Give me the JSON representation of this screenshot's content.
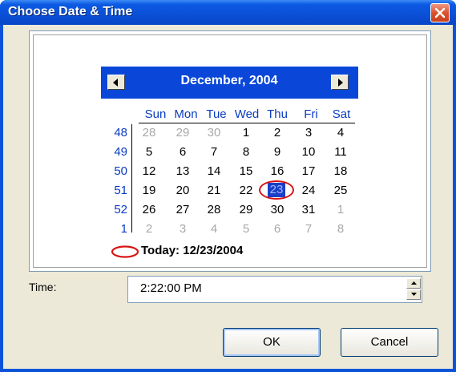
{
  "window": {
    "title": "Choose Date & Time",
    "close_icon": "close-icon"
  },
  "calendar": {
    "month_year": "December, 2004",
    "prev_icon": "triangle-left-icon",
    "next_icon": "triangle-right-icon",
    "days_of_week": [
      "Sun",
      "Mon",
      "Tue",
      "Wed",
      "Thu",
      "Fri",
      "Sat"
    ],
    "week_numbers": [
      "48",
      "49",
      "50",
      "51",
      "52",
      "1"
    ],
    "weeks": [
      [
        "28",
        "29",
        "30",
        "1",
        "2",
        "3",
        "4"
      ],
      [
        "5",
        "6",
        "7",
        "8",
        "9",
        "10",
        "11"
      ],
      [
        "12",
        "13",
        "14",
        "15",
        "16",
        "17",
        "18"
      ],
      [
        "19",
        "20",
        "21",
        "22",
        "23",
        "24",
        "25"
      ],
      [
        "26",
        "27",
        "28",
        "29",
        "30",
        "31",
        "1"
      ],
      [
        "2",
        "3",
        "4",
        "5",
        "6",
        "7",
        "8"
      ]
    ],
    "selected_day": "23",
    "today_label": "Today: 12/23/2004",
    "accent_color": "#0a47d8",
    "highlight_color": "#d81414"
  },
  "time": {
    "label": "Time:",
    "value": "2:22:00 PM"
  },
  "buttons": {
    "ok": "OK",
    "cancel": "Cancel"
  }
}
